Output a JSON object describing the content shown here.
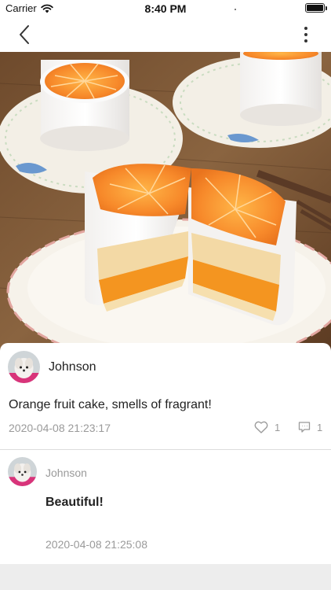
{
  "status_bar": {
    "carrier": "Carrier",
    "time": "8:40 PM",
    "icons": [
      "wifi-icon",
      "battery-icon"
    ]
  },
  "nav": {
    "back_icon": "chevron-left-icon",
    "more_icon": "more-vertical-icon"
  },
  "post": {
    "image": "orange-fruit-cake-photo",
    "author": "Johnson",
    "text": "Orange fruit cake, smells of fragrant!",
    "time": "2020-04-08 21:23:17",
    "likes": "1",
    "comments": "1",
    "like_icon": "heart-icon",
    "comment_icon": "comment-icon"
  },
  "comments": [
    {
      "author": "Johnson",
      "text": "Beautiful!",
      "time": "2020-04-08 21:25:08"
    }
  ],
  "colors": {
    "background": "#ededed",
    "card": "#ffffff",
    "muted_text": "#9a9a9a",
    "primary_text": "#222222"
  }
}
